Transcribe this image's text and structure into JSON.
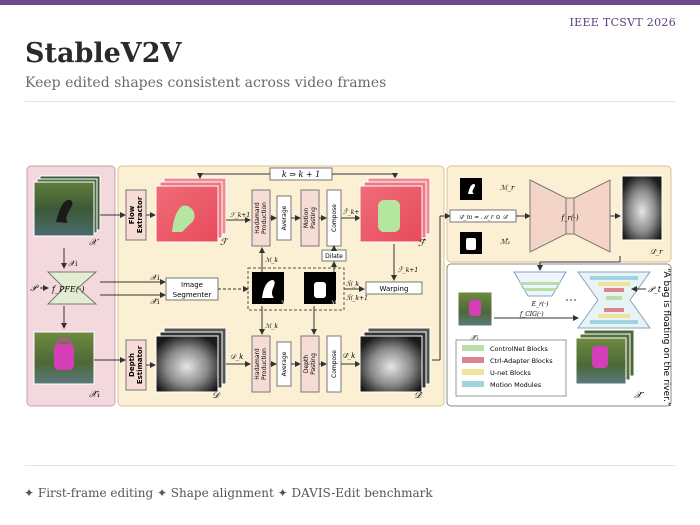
{
  "slide": {
    "venue": "IEEE TCSVT 2026",
    "title": "StableV2V",
    "subtitle": "Keep edited shapes consistent across video frames",
    "footer": "✦ First-frame editing ✦ Shape alignment ✦ DAVIS-Edit benchmark"
  },
  "diagram": {
    "loop": "k ⇒ k + 1",
    "modules": {
      "flow": [
        "Flow",
        "Extractor"
      ],
      "depth": [
        "Depth",
        "Estimator"
      ],
      "segmenter": [
        "Image",
        "Segmenter"
      ],
      "prompter": "f_PFE(·)",
      "hadamard": [
        "Hadamard",
        "Production"
      ],
      "average": "Average",
      "motion_pasting": [
        "Motion",
        "Pasting"
      ],
      "depth_pasting": [
        "Depth",
        "Pasting"
      ],
      "compose": "Compose",
      "dilate": "Dilate",
      "warping": "Warping",
      "fr": "f_r(·)",
      "fcig": "f_CIG(·)",
      "er": "E_r(·)"
    },
    "symbols": {
      "X": "𝒳",
      "X1": "𝒳₁",
      "X1hat": "𝒳̂₁",
      "P": "𝒫",
      "Pt": "𝒫_t",
      "F": "ℱ",
      "Fhat": "ℱ̂",
      "D": "𝒟",
      "Dhat": "𝒟̂",
      "Dk": "𝒟_k",
      "Dkhat": "𝒟̂_k",
      "Drhat": "𝒟̂_r",
      "M": "ℳ",
      "Mhat": "ℳ̂",
      "Mk": "ℳ_k",
      "Mkhat": "ℳ̂_k",
      "Mk1hat": "ℳ̂_k+1",
      "Mr": "ℳ_r",
      "M1hat": "ℳ̂₁",
      "Fk1": "ℱ_k+1",
      "Fhatk1": "ℱ̂_k+1",
      "Fhatk": "ℱ̂_k+1",
      "Dm": "𝒟̂_m = ℳ_r ⊙ 𝒟̂",
      "Xhat": "𝒳̂"
    },
    "legend": [
      {
        "label": "ControlNet Blocks",
        "color": "#b9dfa8"
      },
      {
        "label": "Ctrl-Adapter Blocks",
        "color": "#d9848e"
      },
      {
        "label": "U-net Blocks",
        "color": "#f2e39a"
      },
      {
        "label": "Motion Modules",
        "color": "#9fd3e0"
      }
    ],
    "prompt_text": "“A bag is floating on the river.”",
    "colors": {
      "left_panel": "#f3d9de",
      "middle_panel": "#fbf0d4",
      "right_panel": "#fbf0d4",
      "module": "#f7dcd6",
      "arrow": "#333333"
    }
  }
}
